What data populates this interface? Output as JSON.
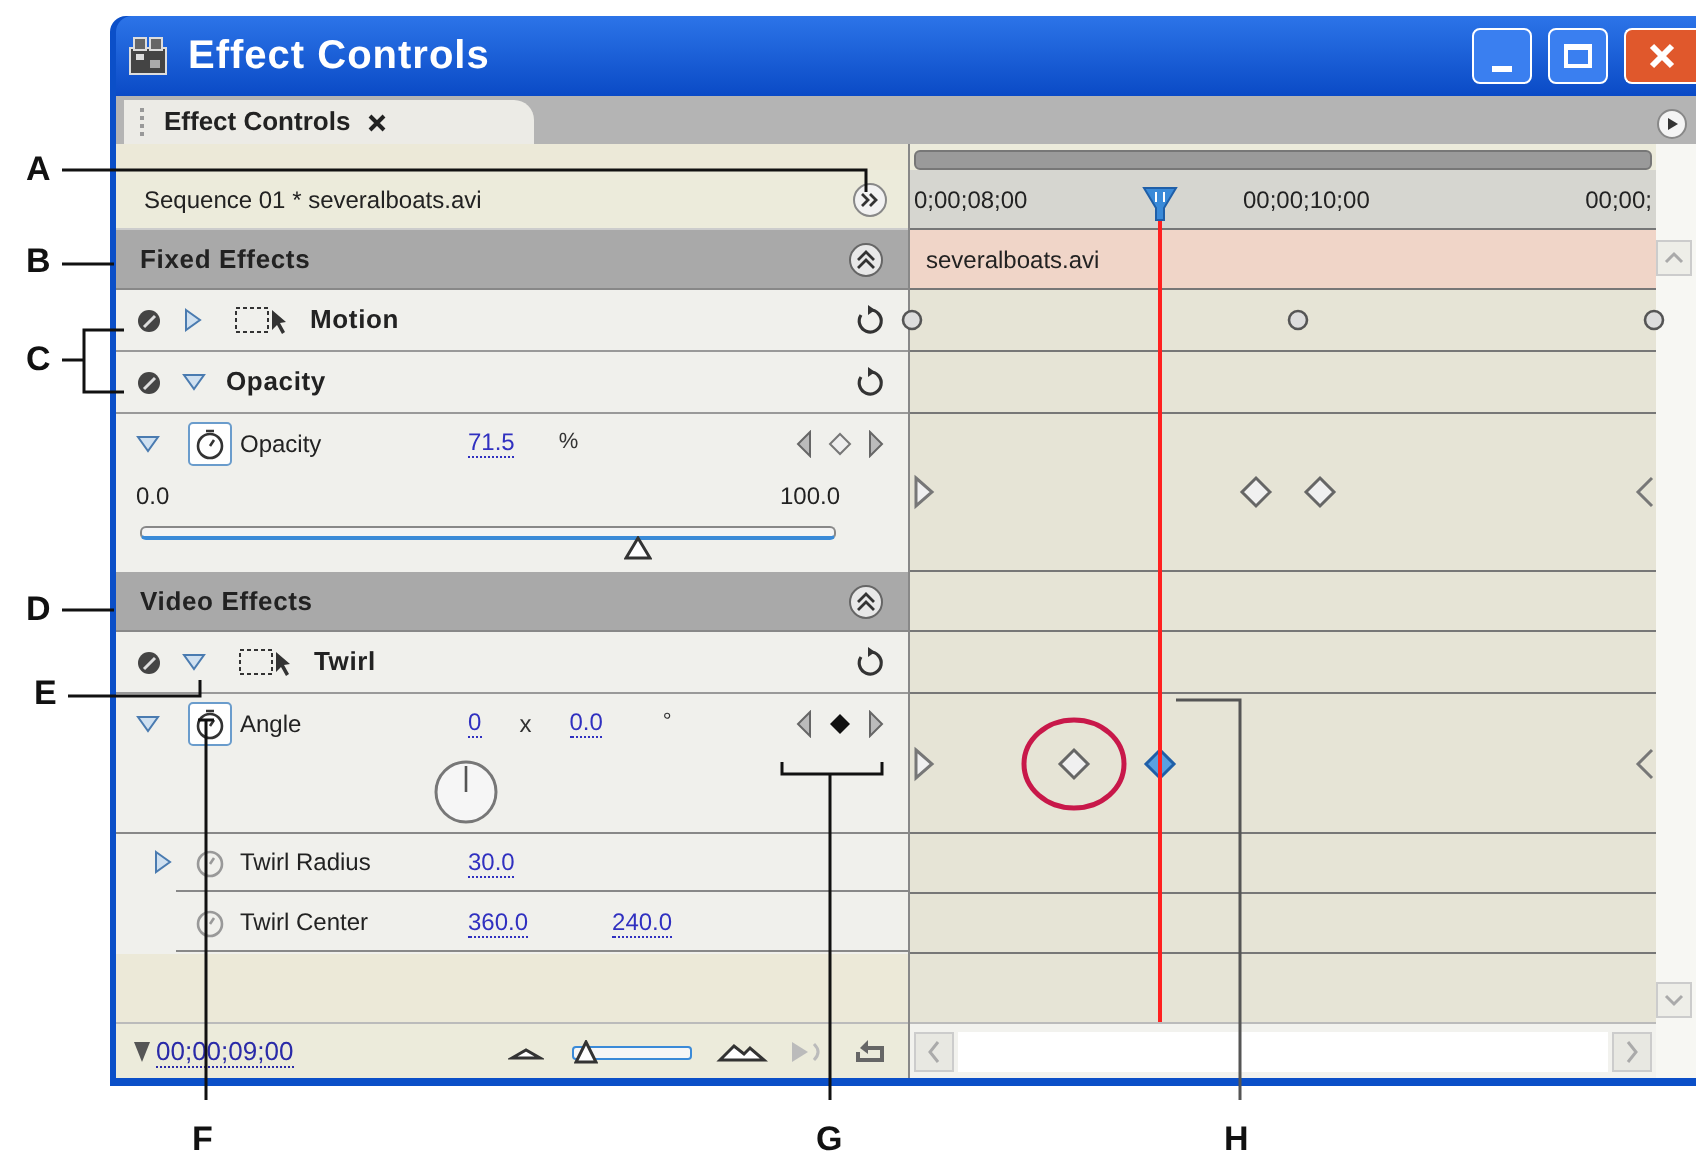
{
  "window": {
    "title": "Effect Controls"
  },
  "tab": {
    "label": "Effect Controls"
  },
  "source": {
    "label": "Sequence 01 * severalboats.avi"
  },
  "timeline": {
    "ruler": [
      "0;00;08;00",
      "00;00;10;00",
      "00;00;"
    ],
    "clip": "severalboats.avi"
  },
  "sections": [
    {
      "title": "Fixed Effects",
      "effects": [
        {
          "name": "Motion",
          "expanded": false,
          "transform_icon": true
        },
        {
          "name": "Opacity",
          "expanded": true,
          "params": [
            {
              "kind": "slider",
              "name": "Opacity",
              "expanded": true,
              "animated": true,
              "on_keyframe": false,
              "values": [
                "71.5"
              ],
              "unit": "%",
              "min": "0.0",
              "max": "100.0",
              "level": 0.715
            }
          ]
        }
      ]
    },
    {
      "title": "Video Effects",
      "effects": [
        {
          "name": "Twirl",
          "expanded": true,
          "transform_icon": true,
          "params": [
            {
              "kind": "dial",
              "name": "Angle",
              "expanded": true,
              "animated": true,
              "on_keyframe": true,
              "values": [
                "0",
                "0.0"
              ],
              "separator": "x",
              "unit": "°"
            },
            {
              "kind": "plain",
              "name": "Twirl Radius",
              "expanded": false,
              "animated": false,
              "values": [
                "30.0"
              ]
            },
            {
              "kind": "plain",
              "name": "Twirl Center",
              "animated": false,
              "values": [
                "360.0",
                "240.0"
              ]
            }
          ]
        }
      ]
    }
  ],
  "footer": {
    "timecode": "00;00;09;00",
    "zoom": {
      "level": 0.1
    }
  },
  "callouts": [
    "A",
    "B",
    "C",
    "D",
    "E",
    "F",
    "G",
    "H"
  ]
}
